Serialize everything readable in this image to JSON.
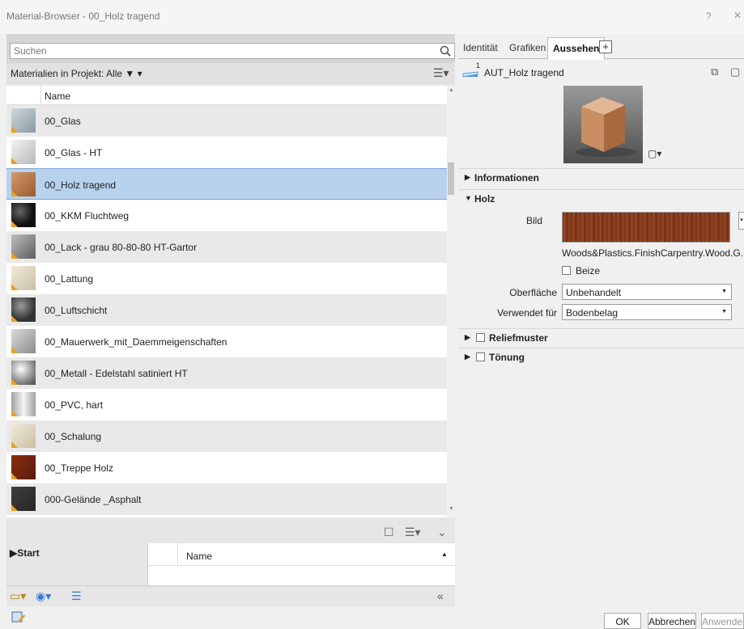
{
  "window": {
    "title": "Material-Browser - 00_Holz tragend",
    "help": "?",
    "close": "✕"
  },
  "search": {
    "placeholder": "Suchen"
  },
  "filter": {
    "label": "Materialien in Projekt: Alle ▼ ▾"
  },
  "list": {
    "column_name": "Name",
    "items": [
      {
        "label": "00_Glas",
        "thumb": "glass"
      },
      {
        "label": "00_Glas - HT",
        "thumb": "glass-light"
      },
      {
        "label": "00_Holz tragend",
        "thumb": "wood",
        "selected": true
      },
      {
        "label": "00_KKM Fluchtweg",
        "thumb": "black-sphere"
      },
      {
        "label": "00_Lack - grau 80-80-80 HT-Gartor",
        "thumb": "grey"
      },
      {
        "label": "00_Lattung",
        "thumb": "beige"
      },
      {
        "label": "00_Luftschicht",
        "thumb": "dark-sphere"
      },
      {
        "label": "00_Mauerwerk_mit_Daemmeigenschaften",
        "thumb": "grey-light"
      },
      {
        "label": "00_Metall - Edelstahl satiniert HT",
        "thumb": "metal"
      },
      {
        "label": "00_PVC, hart",
        "thumb": "cylinder"
      },
      {
        "label": "00_Schalung",
        "thumb": "beige"
      },
      {
        "label": "00_Treppe Holz",
        "thumb": "dark-wood"
      },
      {
        "label": "000-Gelände _Asphalt",
        "thumb": "asphalt"
      }
    ]
  },
  "library": {
    "start": "▶Start",
    "column_name": "Name"
  },
  "tabs": {
    "identity": "Identität",
    "graphics": "Grafiken",
    "appearance": "Aussehen",
    "add": "+"
  },
  "asset": {
    "count": "1",
    "name": "AUT_Holz tragend"
  },
  "sections": {
    "information": "Informationen",
    "wood": "Holz",
    "relief": "Reliefmuster",
    "tint": "Tönung"
  },
  "wood_props": {
    "image_label": "Bild",
    "image_path": "Woods&Plastics.FinishCarpentry.Wood.G...",
    "stain_label": "Beize",
    "finish_label": "Oberfläche",
    "finish_value": "Unbehandelt",
    "used_for_label": "Verwendet für",
    "used_for_value": "Bodenbelag"
  },
  "buttons": {
    "ok": "OK",
    "cancel": "Abbrechen",
    "apply": "Anwenden"
  },
  "colors": {
    "selection": "#b8d2ee",
    "selection_border": "#7ea4cf",
    "wood": "#9a4a27"
  }
}
